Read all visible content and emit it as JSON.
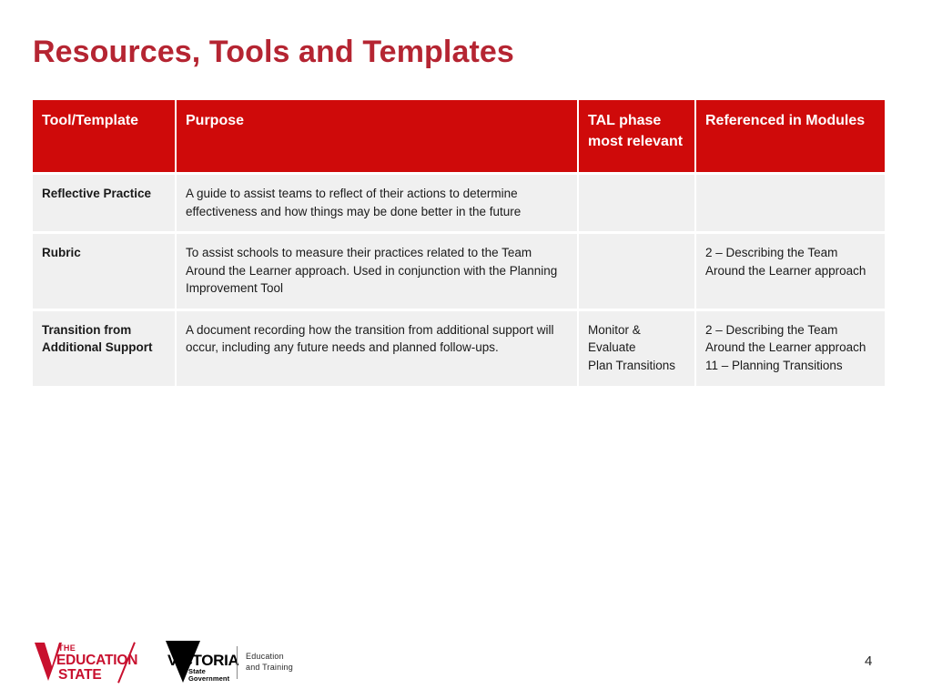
{
  "slide": {
    "title": "Resources, Tools and Templates",
    "page_number": "4",
    "title_color": "#b52532",
    "header_color": "#cf0a0a",
    "row_color": "#f0f0f0"
  },
  "table": {
    "headers": [
      "Tool/Template",
      "Purpose",
      "TAL phase most relevant",
      "Referenced in Modules"
    ],
    "rows": [
      {
        "tool": "Reflective Practice",
        "purpose": "A guide to assist teams to reflect of their actions to determine effectiveness and how things may be done better in the future",
        "phase_lines": [],
        "modules_lines": []
      },
      {
        "tool": "Rubric",
        "purpose": "To assist schools to measure their practices related to the Team Around the Learner approach. Used in conjunction with the Planning Improvement Tool",
        "phase_lines": [],
        "modules_lines": [
          "2 – Describing the Team Around the Learner approach"
        ]
      },
      {
        "tool": "Transition from Additional Support",
        "purpose": "A document recording how the transition from additional support will occur, including any future needs and planned follow-ups.",
        "phase_lines": [
          "Monitor & Evaluate",
          "Plan Transitions"
        ],
        "modules_lines": [
          "2 – Describing the Team Around the Learner approach",
          "11 – Planning Transitions"
        ]
      }
    ]
  },
  "footer": {
    "education_state_logo": {
      "line_the": "THE",
      "line_education": "EDUCATION",
      "line_state": "STATE"
    },
    "victoria_logo": {
      "name": "VICTORIA",
      "sub_line1": "State",
      "sub_line2": "Government",
      "department_line1": "Education",
      "department_line2": "and Training"
    }
  }
}
